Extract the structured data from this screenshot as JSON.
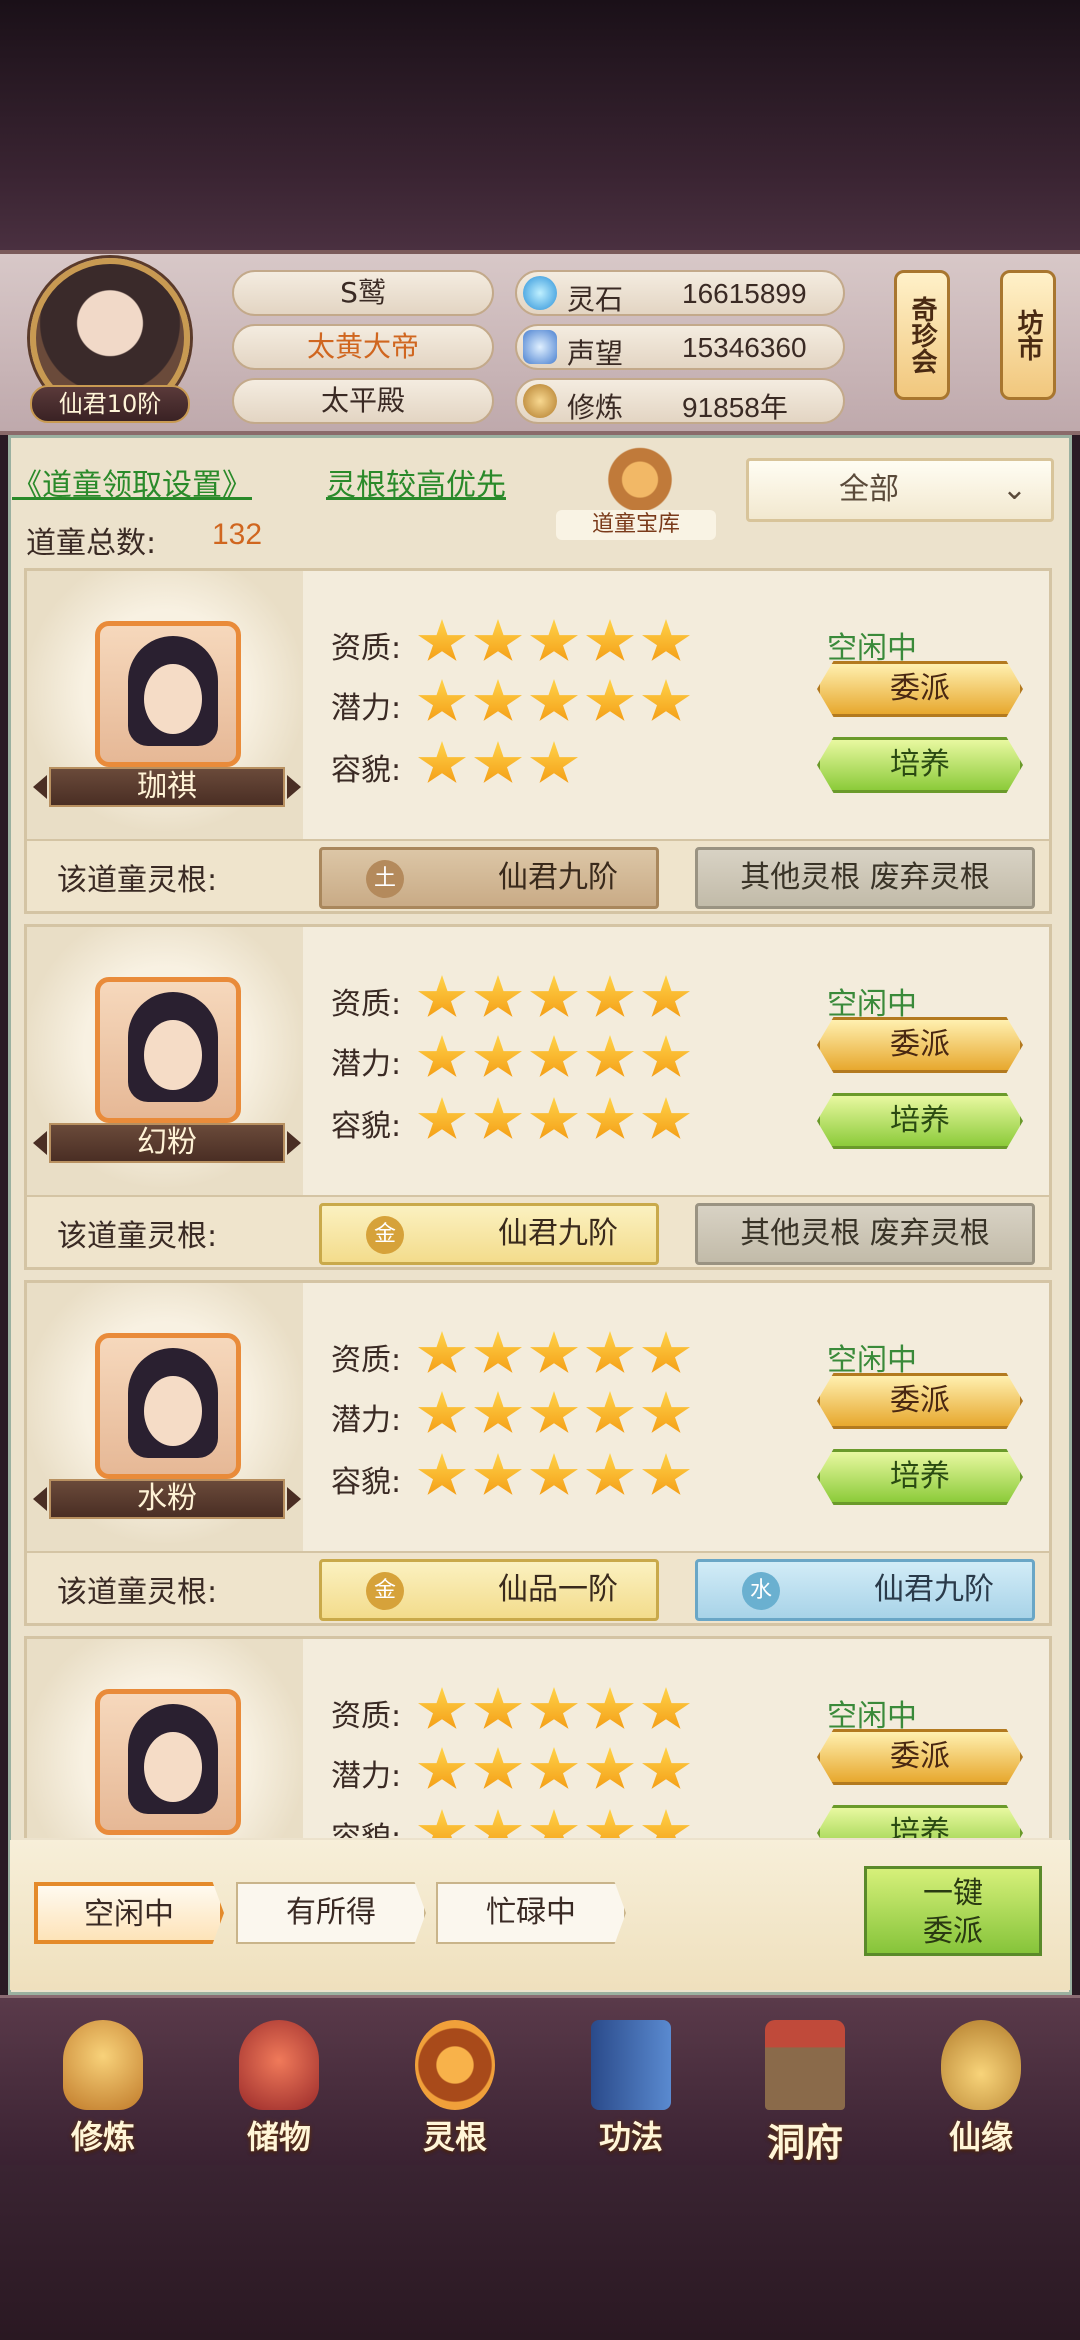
{
  "header": {
    "player_rank": "仙君10阶",
    "name": "S鹫",
    "title": "太黄大帝",
    "sect": "太平殿",
    "resources": [
      {
        "label": "灵石",
        "value": "16615899",
        "icon": "spirit-stone-icon",
        "color": "#4ab0e8"
      },
      {
        "label": "声望",
        "value": "15346360",
        "icon": "prestige-crystal-icon",
        "color": "#6ab0f0"
      },
      {
        "label": "修炼",
        "value": "91858年",
        "icon": "meditation-icon",
        "color": "#c88a3a"
      }
    ],
    "side_buttons": [
      "奇珍会",
      "坊市"
    ]
  },
  "controls": {
    "settings_link": "《道童领取设置》",
    "priority_link": "灵根较高优先",
    "vault_label": "道童宝库",
    "filter_value": "全部",
    "total_label": "道童总数:",
    "total_value": "132"
  },
  "labels": {
    "aptitude": "资质:",
    "potential": "潜力:",
    "looks": "容貌:",
    "root_label": "该道童灵根:",
    "assign": "委派",
    "train": "培养"
  },
  "cards": [
    {
      "name": "珈祺",
      "aptitude": 5,
      "potential": 5,
      "looks": 3,
      "status": "空闲中",
      "root1": {
        "element": "土",
        "text": "仙君九阶",
        "style": "earth"
      },
      "root2": {
        "text": "其他灵根 废弃灵根",
        "style": "other"
      }
    },
    {
      "name": "幻粉",
      "aptitude": 5,
      "potential": 5,
      "looks": 5,
      "status": "空闲中",
      "root1": {
        "element": "金",
        "text": "仙君九阶",
        "style": "gold"
      },
      "root2": {
        "text": "其他灵根 废弃灵根",
        "style": "other"
      }
    },
    {
      "name": "水粉",
      "aptitude": 5,
      "potential": 5,
      "looks": 5,
      "status": "空闲中",
      "root1": {
        "element": "金",
        "text": "仙品一阶",
        "style": "gold"
      },
      "root2": {
        "element": "水",
        "text": "仙君九阶",
        "style": "water"
      }
    },
    {
      "name": "",
      "aptitude": 5,
      "potential": 5,
      "looks": 5,
      "status": "空闲中",
      "root1": {
        "element": "",
        "text": "",
        "style": "gold"
      },
      "root2": {
        "text": "",
        "style": "other"
      }
    }
  ],
  "tabs": [
    {
      "label": "空闲中",
      "active": true
    },
    {
      "label": "有所得",
      "active": false
    },
    {
      "label": "忙碌中",
      "active": false
    }
  ],
  "one_click_label": "一键委派",
  "nav": [
    {
      "label": "修炼",
      "icon": "cultivation-icon",
      "color": "#d89a3a"
    },
    {
      "label": "储物",
      "icon": "storage-bag-icon",
      "color": "#c04a3a"
    },
    {
      "label": "灵根",
      "icon": "spirit-root-icon",
      "color": "#d8742a"
    },
    {
      "label": "功法",
      "icon": "scripture-book-icon",
      "color": "#3a6ab0"
    },
    {
      "label": "洞府",
      "icon": "cave-palace-icon",
      "color": "#9a6a3a"
    },
    {
      "label": "仙缘",
      "icon": "gourd-icon",
      "color": "#d0a04a"
    }
  ]
}
